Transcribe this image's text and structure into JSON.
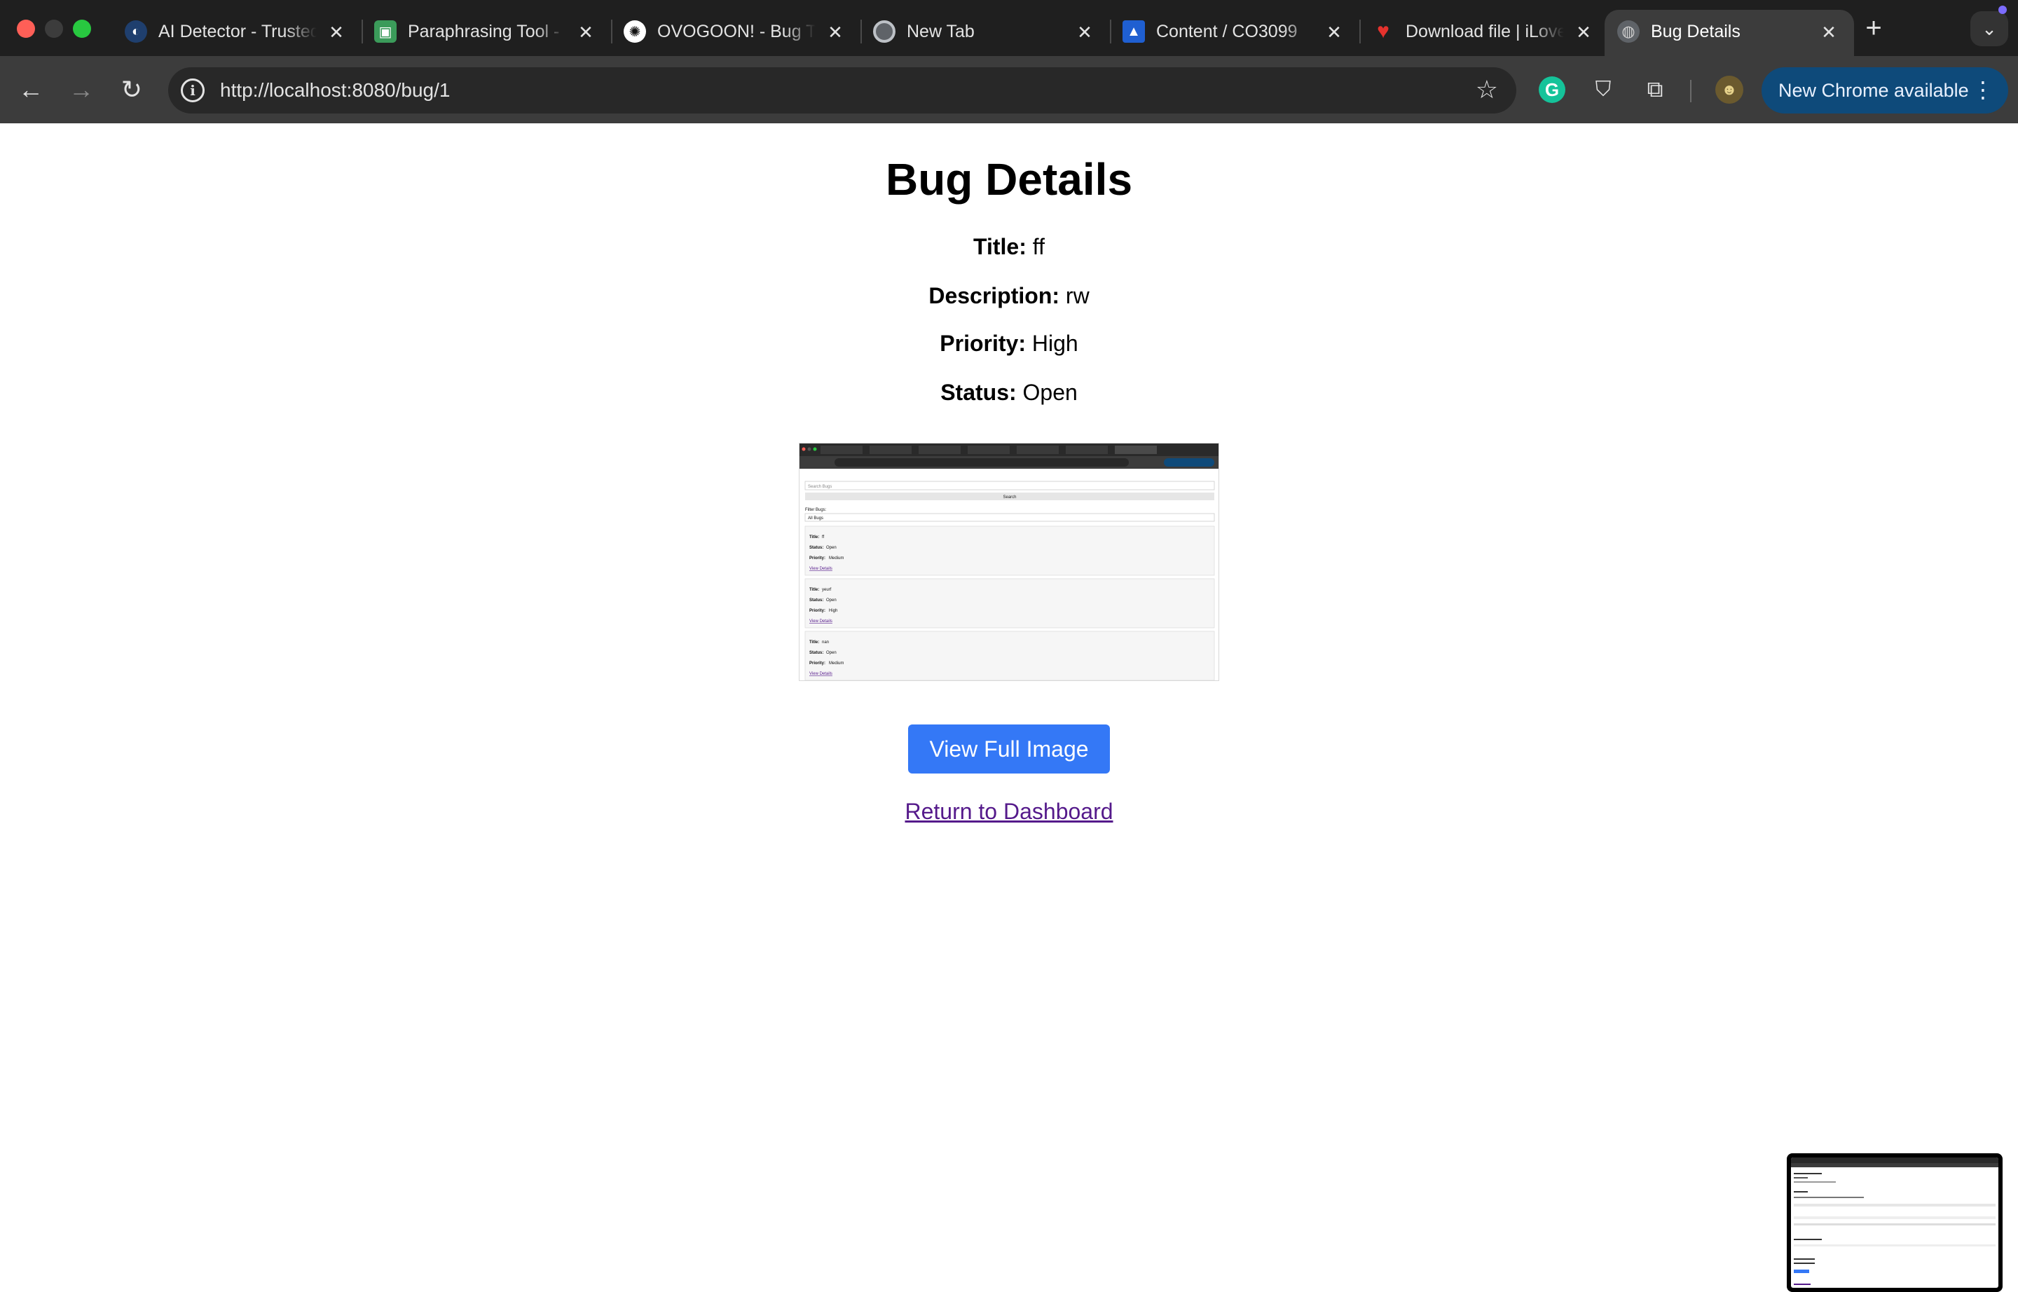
{
  "browser": {
    "tabs": [
      {
        "title": "AI Detector - Trusted",
        "favicon": "ai-detector-favicon",
        "color": "#2b5ea8",
        "active": false
      },
      {
        "title": "Paraphrasing Tool - ",
        "favicon": "paraphrasing-favicon",
        "color": "#3b9b5a",
        "active": false
      },
      {
        "title": "OVOGOON! - Bug Tracker",
        "favicon": "openai-favicon",
        "color": "#ffffff",
        "active": false
      },
      {
        "title": "New Tab",
        "favicon": "chrome-favicon",
        "color": "#9aa0a6",
        "active": false
      },
      {
        "title": "Content / CO3099",
        "favicon": "arrow-favicon",
        "color": "#1f5fd1",
        "active": false
      },
      {
        "title": "Download file | iLovePDF",
        "favicon": "heart-favicon",
        "color": "#e5322d",
        "active": false
      },
      {
        "title": "Bug Details",
        "favicon": "globe-favicon",
        "color": "#9aa0a6",
        "active": true
      }
    ],
    "url": "http://localhost:8080/bug/1",
    "update_label": "New Chrome available"
  },
  "page": {
    "heading": "Bug Details",
    "fields": [
      {
        "label": "Title:",
        "value": "ff"
      },
      {
        "label": "Description:",
        "value": "rw"
      },
      {
        "label": "Priority:",
        "value": "High"
      },
      {
        "label": "Status:",
        "value": "Open"
      }
    ],
    "view_button_label": "View Full Image",
    "return_link_label": "Return to Dashboard"
  },
  "attachment": {
    "search_placeholder": "Search Bugs",
    "search_button": "Search",
    "filter_label": "Filter Bugs:",
    "filter_value": "All Bugs",
    "bugs": [
      {
        "title_label": "Title:",
        "title": "ff",
        "status_label": "Status:",
        "status": "Open",
        "priority_label": "Priority:",
        "priority": "Medium",
        "link": "View Details"
      },
      {
        "title_label": "Title:",
        "title": "yeurf",
        "status_label": "Status:",
        "status": "Open",
        "priority_label": "Priority:",
        "priority": "High",
        "link": "View Details"
      },
      {
        "title_label": "Title:",
        "title": "nan",
        "status_label": "Status:",
        "status": "Open",
        "priority_label": "Priority:",
        "priority": "Medium",
        "link": "View Details"
      }
    ]
  }
}
